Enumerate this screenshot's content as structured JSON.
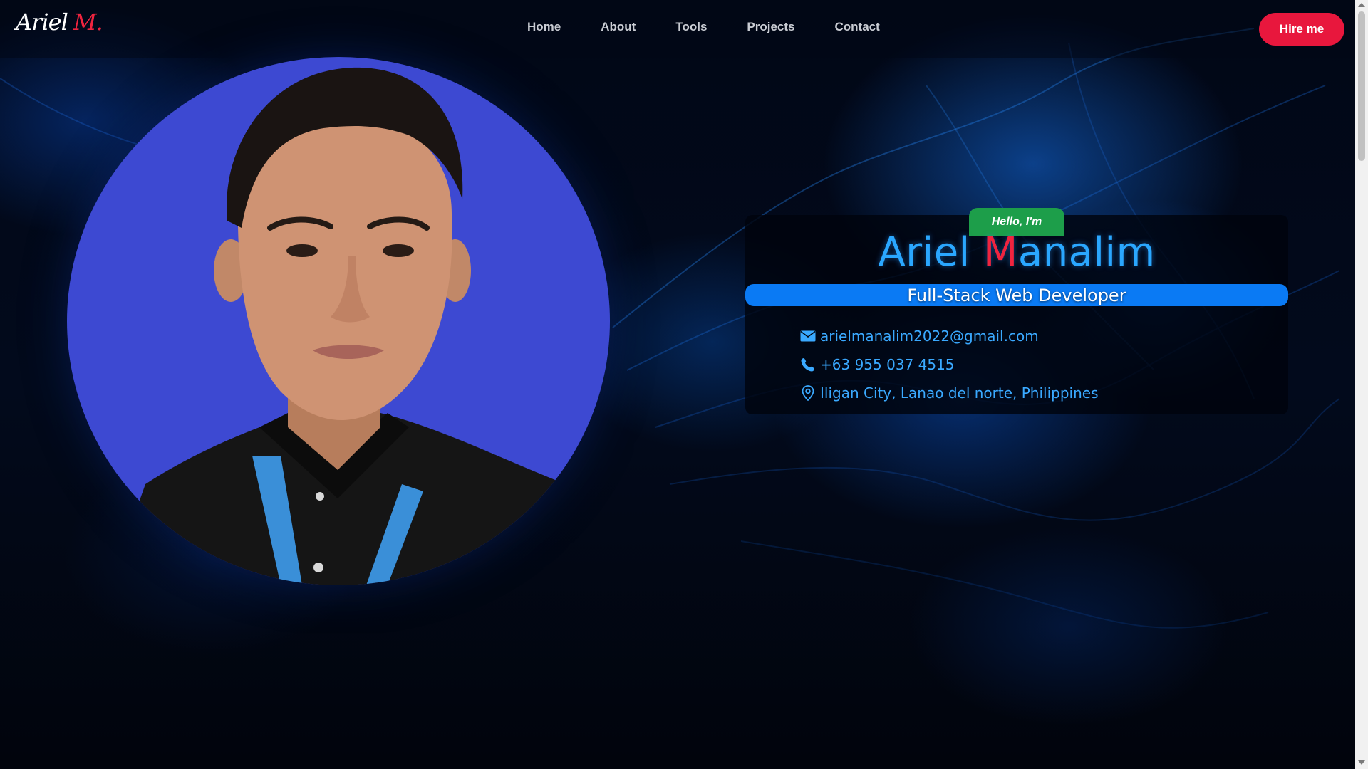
{
  "brand": {
    "first": "Ariel",
    "last": "M."
  },
  "nav": {
    "items": [
      {
        "label": "Home"
      },
      {
        "label": "About"
      },
      {
        "label": "Tools"
      },
      {
        "label": "Projects"
      },
      {
        "label": "Contact"
      }
    ],
    "cta_label": "Hire me"
  },
  "hero": {
    "greeting": "Hello, I'm",
    "name_first": "Ariel",
    "name_initial": "M",
    "name_rest": "analim",
    "role": "Full-Stack Web Developer",
    "contacts": [
      {
        "icon": "envelope-icon",
        "text": "arielmanalim2022@gmail.com"
      },
      {
        "icon": "phone-icon",
        "text": "+63 955 037 4515"
      },
      {
        "icon": "location-pin-icon",
        "text": "Iligan City, Lanao del norte, Philippines"
      }
    ]
  },
  "colors": {
    "accent_red": "#e8173d",
    "accent_blue": "#2aa7ff",
    "role_bar": "#0a7af4",
    "greeting_green": "#1d9e4a",
    "portrait_bg": "#3d49d2"
  }
}
